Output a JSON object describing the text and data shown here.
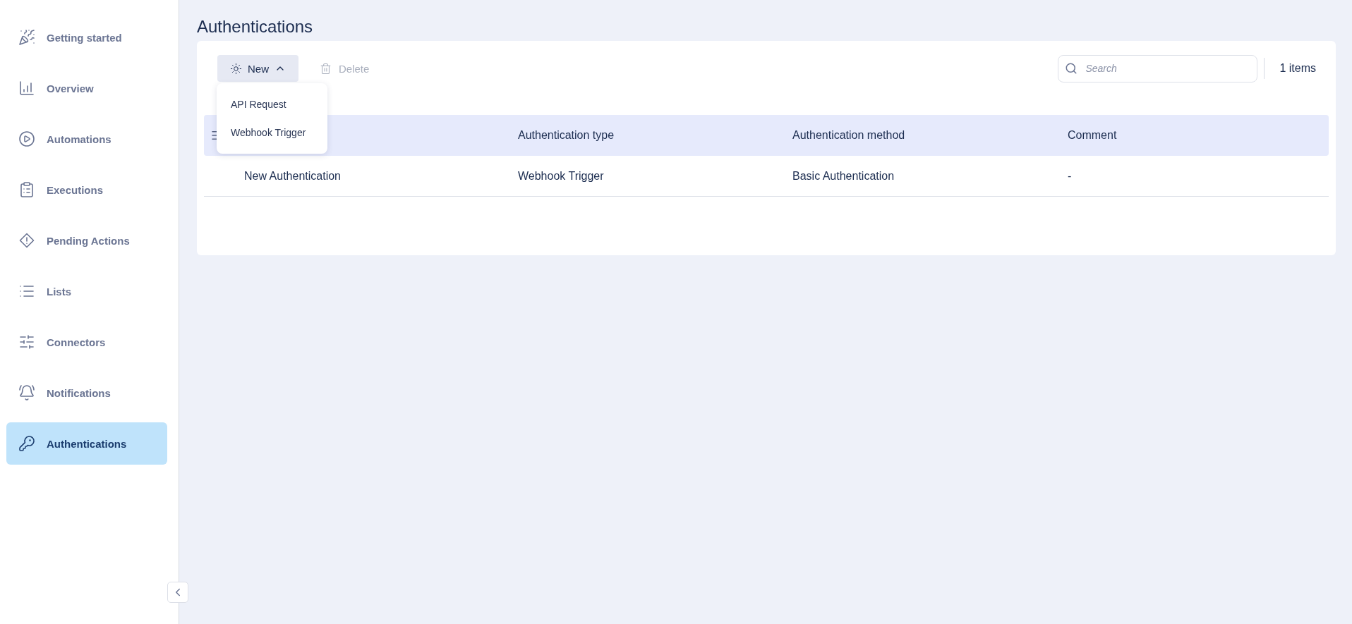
{
  "page_title": "Authentications",
  "sidebar": {
    "items": [
      {
        "label": "Getting started",
        "selected": false
      },
      {
        "label": "Overview",
        "selected": false
      },
      {
        "label": "Automations",
        "selected": false
      },
      {
        "label": "Executions",
        "selected": false
      },
      {
        "label": "Pending Actions",
        "selected": false
      },
      {
        "label": "Lists",
        "selected": false
      },
      {
        "label": "Connectors",
        "selected": false
      },
      {
        "label": "Notifications",
        "selected": false
      },
      {
        "label": "Authentications",
        "selected": true
      }
    ]
  },
  "toolbar": {
    "new_button": {
      "label": "New",
      "expanded": true,
      "menu_items": [
        "API Request",
        "Webhook Trigger"
      ]
    },
    "delete_button": {
      "label": "Delete",
      "disabled": true
    },
    "search": {
      "placeholder": "Search"
    },
    "item_count": "1 items"
  },
  "table": {
    "columns": [
      "",
      "Authentication type",
      "Authentication method",
      "Comment"
    ],
    "rows": [
      {
        "cells": [
          "New Authentication",
          "Webhook Trigger",
          "Basic Authentication",
          "-"
        ]
      }
    ]
  }
}
